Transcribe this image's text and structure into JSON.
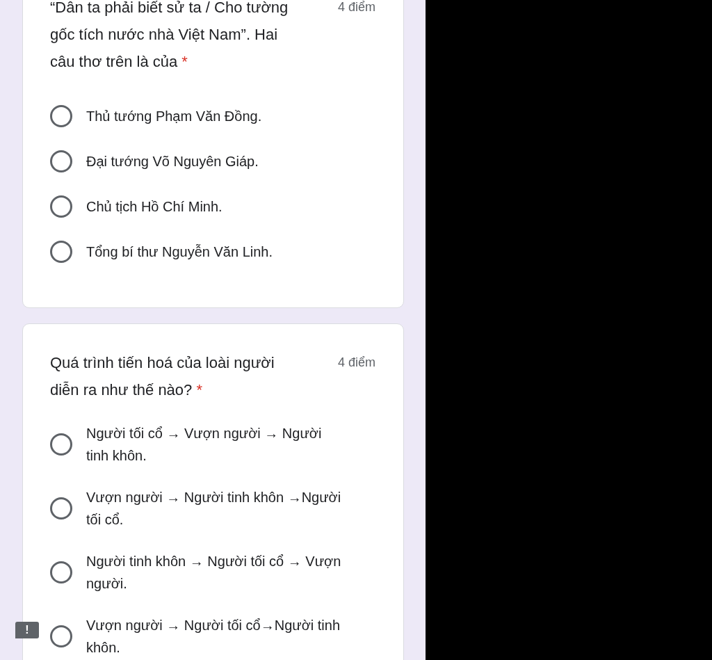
{
  "questions": [
    {
      "title": "“Dân ta phải biết sử ta / Cho tường gốc tích nước nhà Việt Nam”. Hai câu thơ trên là của",
      "required_mark": "*",
      "points": "4 điểm",
      "options": [
        {
          "label": "Thủ tướng Phạm Văn Đồng.",
          "selected": false
        },
        {
          "label": "Đại tướng Võ Nguyên Giáp.",
          "selected": false
        },
        {
          "label": "Chủ tịch Hồ Chí Minh.",
          "selected": false
        },
        {
          "label": "Tổng bí thư Nguyễn Văn Linh.",
          "selected": false
        }
      ]
    },
    {
      "title": "Quá trình tiến hoá của loài người diễn ra như thế nào?",
      "required_mark": "*",
      "points": "4 điểm",
      "options": [
        {
          "label": "Người tối cổ → Vượn người → Người tinh khôn.",
          "selected": false
        },
        {
          "label": "Vượn người → Người tinh khôn →Người tối cổ.",
          "selected": false
        },
        {
          "label": "Người tinh khôn → Người tối cổ → Vượn người.",
          "selected": false
        },
        {
          "label": "Vượn người → Người tối cổ→Người tinh khôn.",
          "selected": false
        }
      ]
    }
  ],
  "feedback_button": {
    "label": "!"
  }
}
